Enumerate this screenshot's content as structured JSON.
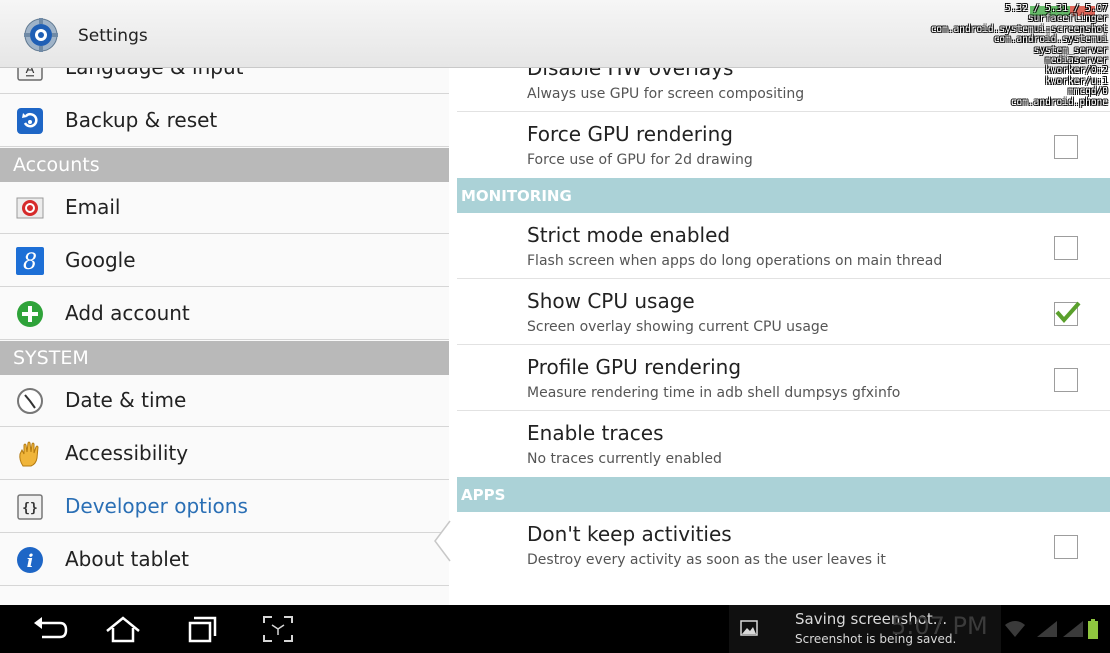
{
  "actionbar": {
    "title": "Settings"
  },
  "cpu_overlay": {
    "lines": [
      "5.32 / 5.31 / 5.07",
      "surfaceflinger",
      "com.android.systemui:screenshot",
      "com.android.systemui",
      "system_server",
      "mediaserver",
      "kworker/0:2",
      "kworker/u:1",
      "mmcqd/0",
      "com.android.phone"
    ]
  },
  "left_pane": {
    "items": [
      {
        "type": "item",
        "label": "Language & input",
        "icon": "language-icon"
      },
      {
        "type": "item",
        "label": "Backup & reset",
        "icon": "backup-icon"
      },
      {
        "type": "header",
        "label": "Accounts"
      },
      {
        "type": "item",
        "label": "Email",
        "icon": "email-icon"
      },
      {
        "type": "item",
        "label": "Google",
        "icon": "google-icon"
      },
      {
        "type": "item",
        "label": "Add account",
        "icon": "add-account-icon"
      },
      {
        "type": "header",
        "label": "SYSTEM"
      },
      {
        "type": "item",
        "label": "Date & time",
        "icon": "clock-icon"
      },
      {
        "type": "item",
        "label": "Accessibility",
        "icon": "hand-icon"
      },
      {
        "type": "item",
        "label": "Developer options",
        "icon": "braces-icon",
        "selected": true
      },
      {
        "type": "item",
        "label": "About tablet",
        "icon": "info-icon"
      }
    ]
  },
  "right_pane": {
    "items": [
      {
        "type": "pref",
        "title": "Disable HW overlays",
        "summary": "Always use GPU for screen compositing",
        "checked": null
      },
      {
        "type": "pref",
        "title": "Force GPU rendering",
        "summary": "Force use of GPU for 2d drawing",
        "checked": false
      },
      {
        "type": "header",
        "label": "MONITORING"
      },
      {
        "type": "pref",
        "title": "Strict mode enabled",
        "summary": "Flash screen when apps do long operations on main thread",
        "checked": false
      },
      {
        "type": "pref",
        "title": "Show CPU usage",
        "summary": "Screen overlay showing current CPU usage",
        "checked": true
      },
      {
        "type": "pref",
        "title": "Profile GPU rendering",
        "summary": "Measure rendering time in adb shell dumpsys gfxinfo",
        "checked": false
      },
      {
        "type": "pref",
        "title": "Enable traces",
        "summary": "No traces currently enabled",
        "checked": null
      },
      {
        "type": "header",
        "label": "APPS"
      },
      {
        "type": "pref",
        "title": "Don't keep activities",
        "summary": "Destroy every activity as soon as the user leaves it",
        "checked": false
      }
    ]
  },
  "navbar": {
    "buttons": [
      "back-icon",
      "home-icon",
      "recent-apps-icon",
      "screenshot-icon"
    ],
    "toast": {
      "title": "Saving screenshot...",
      "subtitle": "Screenshot is being saved."
    },
    "clock": "5:07 PM",
    "status_icons": [
      "wifi-icon",
      "signal-icon",
      "battery-icon"
    ],
    "colors": {
      "battery": "#8fc63f",
      "checkmark": "#5aa02c",
      "monitoring_header": "#abd2d7",
      "left_header": "#b9b9b9",
      "selected_text": "#2a6fb5"
    }
  }
}
